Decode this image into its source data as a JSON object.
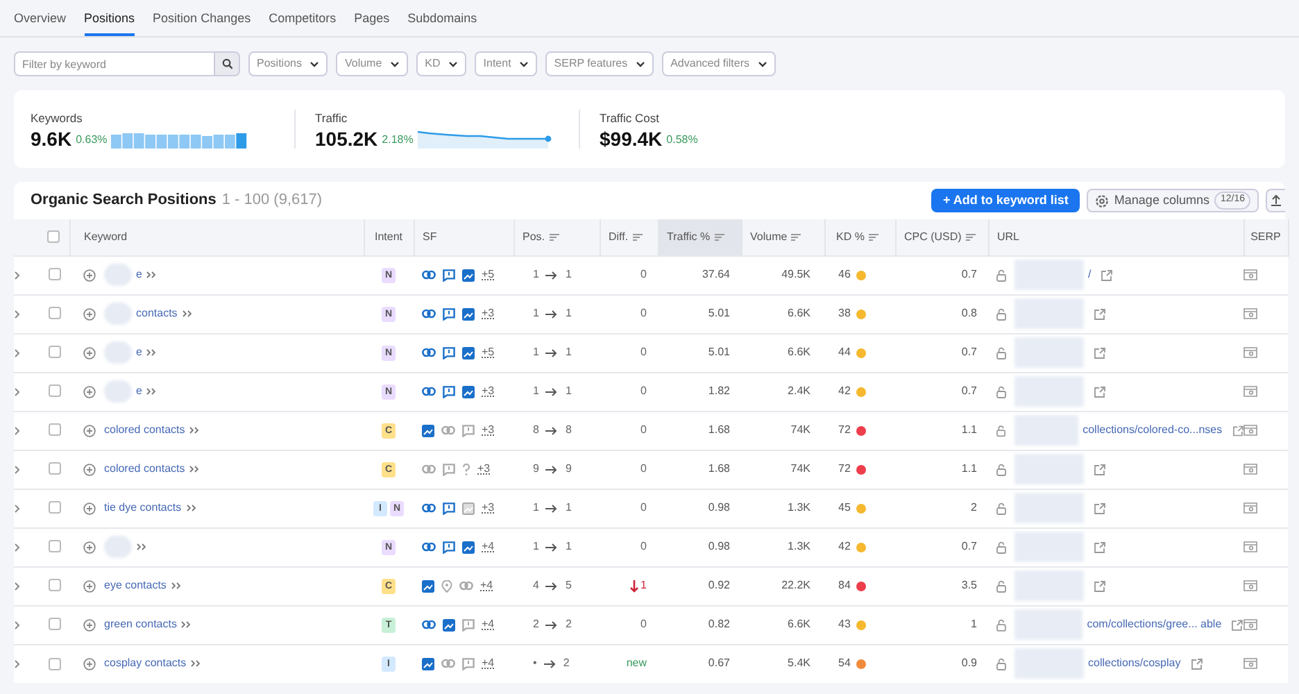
{
  "tabs": [
    {
      "label": "Overview",
      "selected": false
    },
    {
      "label": "Positions",
      "selected": true
    },
    {
      "label": "Position Changes",
      "selected": false
    },
    {
      "label": "Competitors",
      "selected": false
    },
    {
      "label": "Pages",
      "selected": false
    },
    {
      "label": "Subdomains",
      "selected": false
    }
  ],
  "filters": {
    "search": {
      "placeholder": "Filter by keyword"
    },
    "dropdowns": [
      "Positions",
      "Volume",
      "KD",
      "Intent",
      "SERP features",
      "Advanced filters"
    ]
  },
  "summary": [
    {
      "label": "Keywords",
      "value": "9.6K",
      "change": "0.63%",
      "kind": "bars"
    },
    {
      "label": "Traffic",
      "value": "105.2K",
      "change": "2.18%",
      "kind": "line"
    },
    {
      "label": "Traffic Cost",
      "value": "$99.4K",
      "change": "0.58%",
      "kind": "none"
    }
  ],
  "table": {
    "title": "Organic Search Positions",
    "range": "1 - 100 (9,617)",
    "add_button": "+ Add to keyword list",
    "manage_button": "Manage columns",
    "manage_count": "12/16",
    "select_all_checked": false,
    "columns": [
      "Keyword",
      "Intent",
      "SF",
      "Pos.",
      "Diff.",
      "Traffic %",
      "Volume",
      "KD %",
      "CPC (USD)",
      "URL",
      "SERP"
    ],
    "rows": [
      {
        "checked": false,
        "keyword": "e",
        "blurred": true,
        "intent": [
          {
            "label": "N",
            "color": "#e9dcff"
          }
        ],
        "sf": [
          {
            "kind": "link",
            "active": true
          },
          {
            "kind": "review",
            "active": true
          },
          {
            "kind": "image",
            "active": true
          }
        ],
        "sf_more": "+5",
        "pos_from": "1",
        "pos_to": "1",
        "diff": {
          "kind": "same",
          "value": "0"
        },
        "traffic": "37.64",
        "volume": "49.5K",
        "kd": {
          "value": "46",
          "color": "#f5b82e"
        },
        "cpc": "0.7",
        "url": "/"
      },
      {
        "checked": false,
        "keyword": "contacts",
        "blurred": true,
        "intent": [
          {
            "label": "N",
            "color": "#e9dcff"
          }
        ],
        "sf": [
          {
            "kind": "link",
            "active": true
          },
          {
            "kind": "review",
            "active": true
          },
          {
            "kind": "image",
            "active": true
          }
        ],
        "sf_more": "+3",
        "pos_from": "1",
        "pos_to": "1",
        "diff": {
          "kind": "same",
          "value": "0"
        },
        "traffic": "5.01",
        "volume": "6.6K",
        "kd": {
          "value": "38",
          "color": "#f5b82e"
        },
        "cpc": "0.8"
      },
      {
        "checked": false,
        "keyword": "e",
        "blurred": true,
        "intent": [
          {
            "label": "N",
            "color": "#e9dcff"
          }
        ],
        "sf": [
          {
            "kind": "link",
            "active": true
          },
          {
            "kind": "review",
            "active": true
          },
          {
            "kind": "image",
            "active": true
          }
        ],
        "sf_more": "+5",
        "pos_from": "1",
        "pos_to": "1",
        "diff": {
          "kind": "same",
          "value": "0"
        },
        "traffic": "5.01",
        "volume": "6.6K",
        "kd": {
          "value": "44",
          "color": "#f5b82e"
        },
        "cpc": "0.7"
      },
      {
        "checked": false,
        "keyword": "e",
        "blurred": true,
        "intent": [
          {
            "label": "N",
            "color": "#e9dcff"
          }
        ],
        "sf": [
          {
            "kind": "link",
            "active": true
          },
          {
            "kind": "review",
            "active": true
          },
          {
            "kind": "image",
            "active": true
          }
        ],
        "sf_more": "+3",
        "pos_from": "1",
        "pos_to": "1",
        "diff": {
          "kind": "same",
          "value": "0"
        },
        "traffic": "1.82",
        "volume": "2.4K",
        "kd": {
          "value": "42",
          "color": "#f5b82e"
        },
        "cpc": "0.7"
      },
      {
        "checked": false,
        "keyword": "colored contacts",
        "blurred": false,
        "intent": [
          {
            "label": "C",
            "color": "#ffe08a"
          }
        ],
        "sf": [
          {
            "kind": "image",
            "active": true
          },
          {
            "kind": "link",
            "active": false
          },
          {
            "kind": "review",
            "active": false
          }
        ],
        "sf_more": "+3",
        "pos_from": "8",
        "pos_to": "8",
        "diff": {
          "kind": "same",
          "value": "0"
        },
        "traffic": "1.68",
        "volume": "74K",
        "kd": {
          "value": "72",
          "color": "#ee3e4c"
        },
        "cpc": "1.1",
        "url": "collections/colored-co...nses"
      },
      {
        "checked": false,
        "keyword": "colored contacts",
        "blurred": false,
        "intent": [
          {
            "label": "C",
            "color": "#ffe08a"
          }
        ],
        "sf": [
          {
            "kind": "link",
            "active": false
          },
          {
            "kind": "review",
            "active": false
          },
          {
            "kind": "question",
            "active": false
          }
        ],
        "sf_more": "+3",
        "pos_from": "9",
        "pos_to": "9",
        "diff": {
          "kind": "same",
          "value": "0"
        },
        "traffic": "1.68",
        "volume": "74K",
        "kd": {
          "value": "72",
          "color": "#ee3e4c"
        },
        "cpc": "1.1"
      },
      {
        "checked": false,
        "keyword": "tie dye contacts",
        "blurred": false,
        "intent": [
          {
            "label": "I",
            "color": "#d3e9ff"
          },
          {
            "label": "N",
            "color": "#e9dcff"
          }
        ],
        "sf": [
          {
            "kind": "link",
            "active": true
          },
          {
            "kind": "review",
            "active": true
          },
          {
            "kind": "image",
            "active": false
          }
        ],
        "sf_more": "+3",
        "pos_from": "1",
        "pos_to": "1",
        "diff": {
          "kind": "same",
          "value": "0"
        },
        "traffic": "0.98",
        "volume": "1.3K",
        "kd": {
          "value": "45",
          "color": "#f5b82e"
        },
        "cpc": "2"
      },
      {
        "checked": false,
        "blurred": true,
        "intent": [
          {
            "label": "N",
            "color": "#e9dcff"
          }
        ],
        "sf": [
          {
            "kind": "link",
            "active": true
          },
          {
            "kind": "review",
            "active": true
          },
          {
            "kind": "image",
            "active": true
          }
        ],
        "sf_more": "+4",
        "pos_from": "1",
        "pos_to": "1",
        "diff": {
          "kind": "same",
          "value": "0"
        },
        "traffic": "0.98",
        "volume": "1.3K",
        "kd": {
          "value": "42",
          "color": "#f5b82e"
        },
        "cpc": "0.7"
      },
      {
        "checked": false,
        "keyword": "eye contacts",
        "blurred": false,
        "intent": [
          {
            "label": "C",
            "color": "#ffe08a"
          }
        ],
        "sf": [
          {
            "kind": "image",
            "active": true
          },
          {
            "kind": "pin",
            "active": false
          },
          {
            "kind": "link",
            "active": false
          }
        ],
        "sf_more": "+4",
        "pos_from": "4",
        "pos_to": "5",
        "diff": {
          "kind": "down",
          "value": "1"
        },
        "traffic": "0.92",
        "volume": "22.2K",
        "kd": {
          "value": "84",
          "color": "#ee3e4c"
        },
        "cpc": "3.5"
      },
      {
        "checked": false,
        "keyword": "green contacts",
        "blurred": false,
        "intent": [
          {
            "label": "T",
            "color": "#c8f0d8"
          }
        ],
        "sf": [
          {
            "kind": "link",
            "active": true
          },
          {
            "kind": "image",
            "active": true
          },
          {
            "kind": "review",
            "active": false
          }
        ],
        "sf_more": "+4",
        "pos_from": "2",
        "pos_to": "2",
        "diff": {
          "kind": "same",
          "value": "0"
        },
        "traffic": "0.82",
        "volume": "6.6K",
        "kd": {
          "value": "43",
          "color": "#f5b82e"
        },
        "cpc": "1",
        "url": "com/collections/gree... able"
      },
      {
        "checked": false,
        "keyword": "cosplay contacts",
        "blurred": false,
        "intent": [
          {
            "label": "I",
            "color": "#d3e9ff"
          }
        ],
        "sf": [
          {
            "kind": "image",
            "active": true
          },
          {
            "kind": "link",
            "active": false
          },
          {
            "kind": "review",
            "active": false
          }
        ],
        "sf_more": "+4",
        "pos_from": "•",
        "pos_to": "2",
        "diff": {
          "kind": "new",
          "value": "new"
        },
        "traffic": "0.67",
        "volume": "5.4K",
        "kd": {
          "value": "54",
          "color": "#f28a3c"
        },
        "cpc": "0.9",
        "url": "collections/cosplay"
      }
    ]
  }
}
